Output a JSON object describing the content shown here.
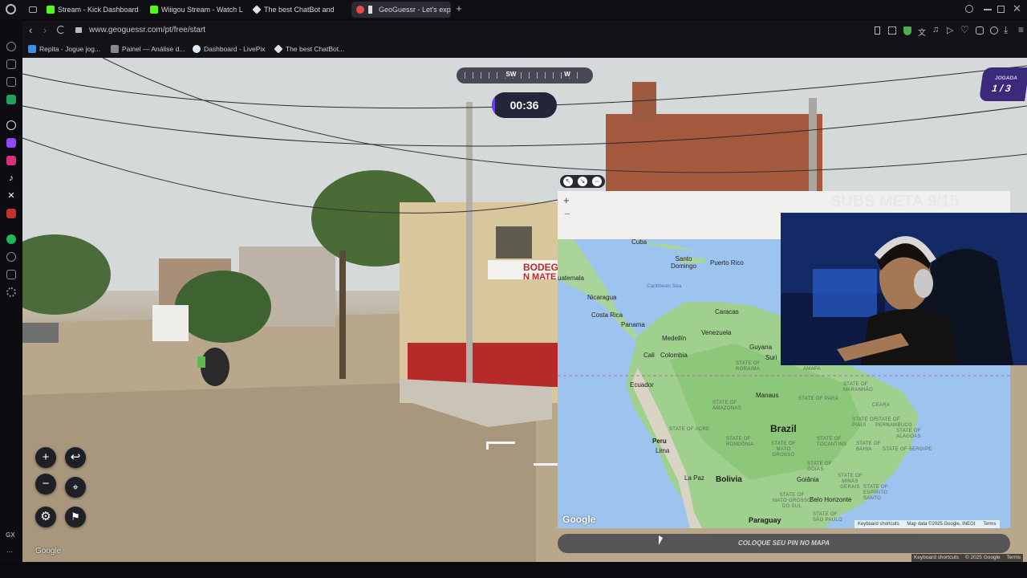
{
  "tabs": [
    {
      "label": "Stream - Kick Dashboard",
      "icon": "kick-icon"
    },
    {
      "label": "Wiiigou Stream - Watch L",
      "icon": "kick-icon"
    },
    {
      "label": "The best ChatBot and",
      "icon": "chatbot-icon"
    },
    {
      "label": "GeoGuessr - Let's exp",
      "icon": "geoguessr-icon"
    }
  ],
  "address": {
    "url": "www.geoguessr.com/pt/free/start"
  },
  "bookmarks": [
    {
      "label": "Repita - Jogue jog..."
    },
    {
      "label": "Painel — Análise d..."
    },
    {
      "label": "Dashboard - LivePix"
    },
    {
      "label": "The best ChatBot..."
    }
  ],
  "sidebar": {
    "gx_label": "GX",
    "more_label": "..."
  },
  "compass": {
    "labels": [
      "SW",
      "W"
    ]
  },
  "timer": {
    "value": "00:36",
    "progress": 0.1
  },
  "round": {
    "label": "JOGADA",
    "value": "1 / 3"
  },
  "shop_sign": {
    "line1": "BODEGA",
    "line2": "N MATE"
  },
  "subs": {
    "text": "SUBS META 9/15"
  },
  "map": {
    "labels": {
      "cuba": "Cuba",
      "santo_domingo": "Santo\nDomingo",
      "puerto_rico": "Puerto Rico",
      "guatemala": "uatemala",
      "caribbean": "Caribbean Sea",
      "nicaragua": "Nicaragua",
      "costa_rica": "Costa Rica",
      "panama": "Panama",
      "caracas": "Caracas",
      "medellin": "Medellín",
      "venezuela": "Venezuela",
      "cali": "Cali",
      "colombia": "Colombia",
      "guyana": "Guyana",
      "suri": "Suri",
      "ecuador": "Ecuador",
      "manaus": "Manaus",
      "brazil": "Brazil",
      "peru": "Peru",
      "lima": "Lima",
      "la_paz": "La Paz",
      "bolivia": "Bolivia",
      "goiania": "Goiânia",
      "belo_horizonte": "Belo Horizonte",
      "paraguay": "Paraguay",
      "st_roraima": "STATE OF\nRORAIMA",
      "st_amapa": "STATE OF\nAMAPA",
      "st_amazonas": "STATE OF\nAMAZONAS",
      "st_para": "STATE OF PARÁ",
      "st_maranhao": "STATE OF\nMARANHÃO",
      "st_ceara": "CEARA",
      "st_piaui": "STATE OF\nPIAUÍ",
      "st_acre": "STATE OF ACRE",
      "st_rondonia": "STATE OF\nRONDÔNIA",
      "st_tocantins": "STATE OF\nTOCANTINS",
      "st_bahia": "STATE OF\nBAHIA",
      "st_pernambuco": "STATE OF\nPERNAMBUCO",
      "st_alagoas": "STATE OF\nALAGOAS",
      "st_sergipe": "STATE OF SERGIPE",
      "st_mato_grosso": "STATE OF\nMATO\nGROSSO",
      "st_goias": "STATE OF\nGOIÁS",
      "st_minas": "STATE OF\nMINAS\nGERAIS",
      "st_espirito": "STATE OF\nESPÍRITO\nSANTO",
      "st_mgs": "STATE OF\nMATO GROSSO\nDO SUL",
      "st_sao_paulo": "STATE OF\nSÃO PAULO"
    },
    "google": "Google",
    "attrib": {
      "shortcuts": "Keyboard shortcuts",
      "data": "Map data ©2025 Google, INEGI",
      "terms": "Terms"
    }
  },
  "guess_button": {
    "label": "COLOQUE SEU PIN NO MAPA"
  },
  "street_google": "Google",
  "footer": {
    "shortcuts": "Keyboard shortcuts",
    "copy": "© 2025 Google",
    "terms": "Terms"
  },
  "colors": {
    "accent": "#6c3df0",
    "panel": "#25253a",
    "round_badge": "#3b2a7a"
  }
}
